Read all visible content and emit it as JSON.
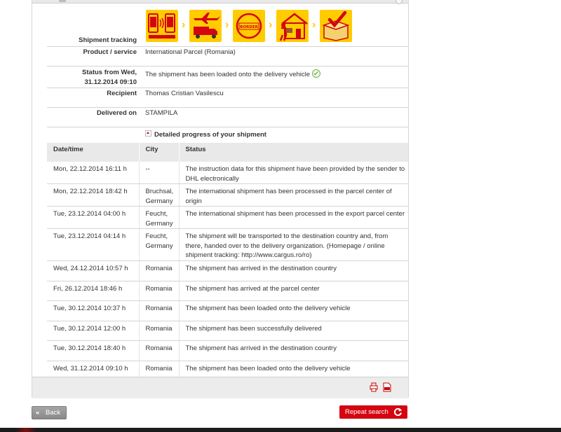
{
  "tracking": {
    "shipment_tracking_label": "Shipment tracking",
    "product_label": "Product / service",
    "product_value": "International Parcel (Romania)",
    "status_label_line1": "Status from Wed,",
    "status_label_line2": "31.12.2014 09:10",
    "status_value": "The shipment has been loaded onto the delivery vehicle",
    "recipient_label": "Recipient",
    "recipient_value": "Thomas Cristian Vasilescu",
    "delivered_label": "Delivered on",
    "delivered_value": "STAMPILA"
  },
  "progress_steps": [
    {
      "icon": "mobile-data-icon"
    },
    {
      "icon": "plane-truck-icon"
    },
    {
      "icon": "customs-border-icon"
    },
    {
      "icon": "home-delivery-icon"
    },
    {
      "icon": "delivered-box-icon"
    }
  ],
  "progress_step_border_label": "BORDER",
  "detail": {
    "toggle_label": "Detailed progress of your shipment",
    "columns": [
      "Date/time",
      "City",
      "Status"
    ],
    "rows": [
      {
        "datetime": "Mon, 22.12.2014 16:11 h",
        "city": "--",
        "status": "The instruction data for this shipment have been provided by the sender to DHL electronically"
      },
      {
        "datetime": "Mon, 22.12.2014 18:42 h",
        "city": "Bruchsal, Germany",
        "status": "The international shipment has been processed in the parcel center of origin"
      },
      {
        "datetime": "Tue, 23.12.2014 04:00 h",
        "city": "Feucht, Germany",
        "status": "The international shipment has been processed in the export parcel center"
      },
      {
        "datetime": "Tue, 23.12.2014 04:14 h",
        "city": "Feucht, Germany",
        "status": "The shipment will be transported to the destination country and, from there, handed over to the delivery organization. (Homepage / online shipment tracking: http://www.cargus.ro/ro)"
      },
      {
        "datetime": "Wed, 24.12.2014 10:57 h",
        "city": "Romania",
        "status": "The shipment has arrived in the destination country"
      },
      {
        "datetime": "Fri, 26.12.2014 18:46 h",
        "city": "Romania",
        "status": "The shipment has arrived at the parcel center"
      },
      {
        "datetime": "Tue, 30.12.2014 10:37 h",
        "city": "Romania",
        "status": "The shipment has been loaded onto the delivery vehicle"
      },
      {
        "datetime": "Tue, 30.12.2014 12:00 h",
        "city": "Romania",
        "status": "The shipment has been successfully delivered"
      },
      {
        "datetime": "Tue, 30.12.2014 18:40 h",
        "city": "Romania",
        "status": "The shipment has arrived in the destination country"
      },
      {
        "datetime": "Wed, 31.12.2014 09:10 h",
        "city": "Romania",
        "status": "The shipment has been loaded onto the delivery vehicle"
      }
    ]
  },
  "footer": {
    "back_label": "Back",
    "repeat_label": "Repeat search"
  },
  "colors": {
    "dhl_yellow": "#ffcc00",
    "dhl_red": "#d40511",
    "header_gray": "#e9e9e9"
  }
}
